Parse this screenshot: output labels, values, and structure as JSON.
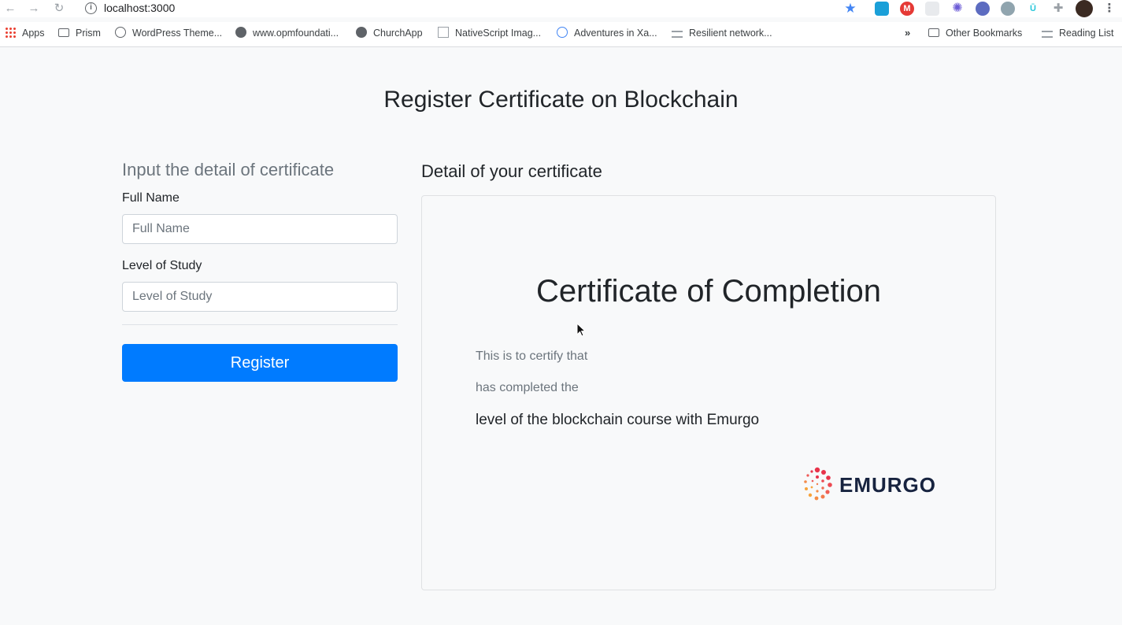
{
  "browser": {
    "url": "localhost:3000",
    "bookmarks": [
      {
        "label": "Apps",
        "icon": "apps-grid-icon"
      },
      {
        "label": "Prism",
        "icon": "folder-icon"
      },
      {
        "label": "WordPress Theme...",
        "icon": "wordpress-icon"
      },
      {
        "label": "www.opmfoundati...",
        "icon": "globe-icon"
      },
      {
        "label": "ChurchApp",
        "icon": "globe-icon"
      },
      {
        "label": "NativeScript Imag...",
        "icon": "document-icon"
      },
      {
        "label": "Adventures in Xa...",
        "icon": "wordpress-icon"
      },
      {
        "label": "Resilient network...",
        "icon": "list-icon"
      }
    ],
    "overflow_label": "»",
    "other_bookmarks": "Other Bookmarks",
    "reading_list": "Reading List"
  },
  "page": {
    "title": "Register Certificate on Blockchain"
  },
  "form": {
    "heading": "Input the detail of certificate",
    "full_name_label": "Full Name",
    "full_name_placeholder": "Full Name",
    "level_label": "Level of Study",
    "level_placeholder": "Level of Study",
    "register_label": "Register"
  },
  "certificate": {
    "heading": "Detail of your certificate",
    "title": "Certificate of Completion",
    "line1": "This is to certify that",
    "line2": "has completed the",
    "line3": "level of the blockchain course with Emurgo",
    "logo_text": "EMURGO"
  },
  "colors": {
    "primary": "#007bff",
    "muted": "#6c757d",
    "logo_red": "#e8334a",
    "logo_orange": "#f7a33b"
  }
}
